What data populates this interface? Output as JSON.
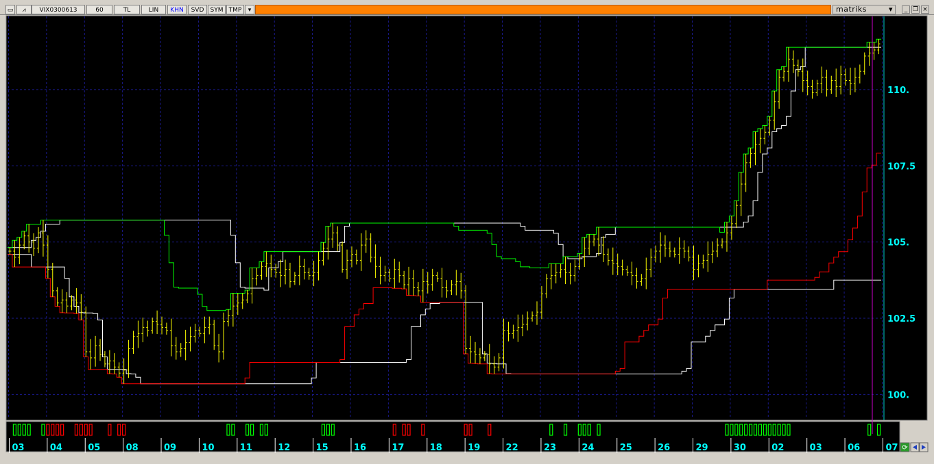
{
  "toolbar": {
    "symbol": "VIX0300613",
    "period": "60",
    "currency": "TL",
    "scale": "LIN",
    "khn": "KHN",
    "svd": "SVD",
    "sym": "SYM",
    "tmp": "TMP",
    "brand": "matriks",
    "colors": {
      "orange_bar": "#ff8000",
      "khn_text": "#0000ff"
    }
  },
  "chart_data": {
    "type": "line",
    "subtype": "ohlc-bars-with-channel",
    "ylim": [
      99.2,
      112.4
    ],
    "yticks": [
      "100.",
      "102.5",
      "105.",
      "107.5",
      "110."
    ],
    "ytick_values": [
      100,
      102.5,
      105,
      107.5,
      110
    ],
    "xticks": [
      "03",
      "04",
      "05",
      "08",
      "09",
      "10",
      "11",
      "12",
      "15",
      "16",
      "17",
      "18",
      "19",
      "22",
      "23",
      "24",
      "25",
      "26",
      "29",
      "30",
      "02",
      "03",
      "06",
      "07"
    ],
    "grid": true,
    "colors": {
      "background": "#000000",
      "bars": "#ffff00",
      "upper": "#00ff00",
      "lower": "#ff0000",
      "outer": "#ffffff",
      "grid": "#1a1a8c",
      "axis_text": "#00ffff",
      "cursor": "#cc00cc"
    },
    "bars_per_day": 8,
    "close": [
      104.7,
      104.5,
      104.9,
      105.2,
      105.0,
      104.8,
      105.3,
      104.9,
      104.1,
      103.4,
      103.0,
      103.1,
      102.9,
      103.1,
      103.0,
      102.7,
      101.4,
      101.2,
      101.6,
      101.3,
      101.0,
      101.1,
      100.9,
      100.7,
      100.8,
      101.5,
      101.9,
      102.0,
      102.2,
      102.1,
      102.4,
      102.3,
      102.2,
      102.1,
      101.6,
      101.4,
      101.5,
      101.7,
      101.9,
      102.1,
      102.0,
      102.2,
      102.3,
      101.6,
      101.4,
      102.4,
      102.6,
      102.9,
      103.0,
      103.1,
      103.3,
      103.8,
      103.9,
      104.2,
      104.3,
      104.1,
      104.0,
      103.9,
      104.1,
      103.7,
      103.9,
      104.2,
      104.0,
      103.9,
      104.0,
      104.4,
      104.8,
      105.1,
      105.3,
      104.9,
      104.1,
      104.4,
      104.6,
      104.4,
      104.9,
      105.1,
      104.5,
      104.2,
      103.9,
      104.0,
      103.8,
      104.1,
      103.9,
      103.6,
      103.8,
      103.5,
      103.4,
      103.7,
      103.6,
      103.9,
      103.8,
      103.5,
      103.4,
      103.6,
      103.7,
      103.4,
      101.5,
      101.4,
      101.3,
      101.2,
      101.3,
      101.0,
      100.9,
      101.2,
      102.1,
      102.0,
      102.1,
      102.2,
      102.3,
      102.5,
      102.6,
      102.7,
      103.3,
      103.8,
      103.9,
      104.0,
      104.1,
      104.0,
      103.9,
      104.2,
      104.5,
      104.8,
      105.0,
      105.1,
      104.9,
      104.6,
      104.4,
      104.3,
      104.2,
      104.1,
      104.0,
      103.9,
      103.7,
      103.8,
      104.1,
      104.5,
      104.7,
      104.9,
      104.8,
      104.7,
      104.6,
      104.8,
      104.7,
      104.5,
      104.1,
      104.3,
      104.4,
      104.6,
      104.7,
      104.9,
      105.0,
      105.3,
      105.6,
      106.2,
      106.9,
      107.6,
      107.9,
      108.2,
      108.4,
      108.6,
      109.0,
      109.6,
      110.4,
      110.6,
      111.0,
      110.8,
      110.6,
      110.3,
      110.1,
      109.9,
      110.2,
      110.4,
      110.0,
      110.3,
      110.1,
      110.5,
      110.3,
      110.2,
      110.4,
      110.6,
      111.1,
      111.2,
      111.3,
      111.5
    ]
  }
}
